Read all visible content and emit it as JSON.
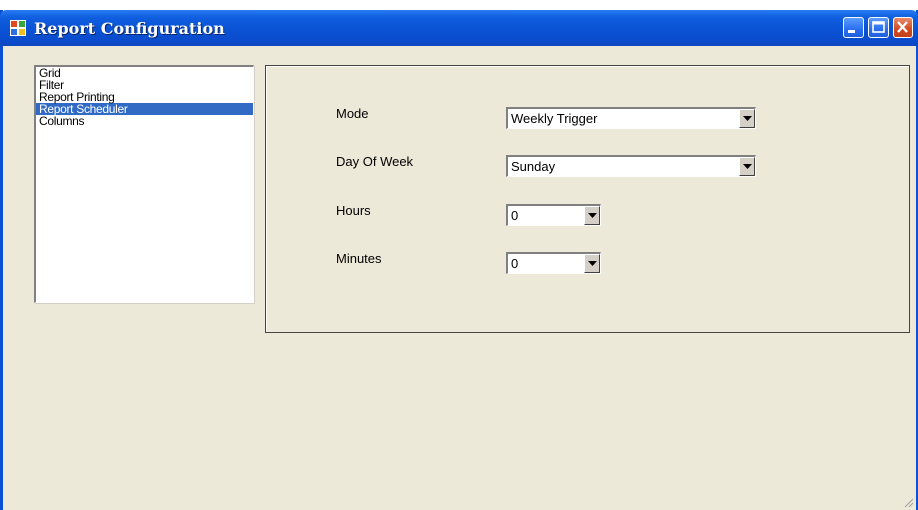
{
  "window": {
    "title": "Report Configuration"
  },
  "titlebar_buttons": [
    "minimize-icon",
    "maximize-icon",
    "close-icon"
  ],
  "sidebar": {
    "items": [
      "Grid",
      "Filter",
      "Report Printing",
      "Report Scheduler",
      "Columns"
    ],
    "selected": "Report Scheduler"
  },
  "form": {
    "mode": {
      "label": "Mode",
      "value": "Weekly Trigger"
    },
    "day_of_week": {
      "label": "Day Of Week",
      "value": "Sunday"
    },
    "hours": {
      "label": "Hours",
      "value": "0"
    },
    "minutes": {
      "label": "Minutes",
      "value": "0"
    }
  },
  "colors": {
    "titlebar": "#0a52d4",
    "selection": "#316ac5",
    "window_bg": "#ece9d8"
  }
}
